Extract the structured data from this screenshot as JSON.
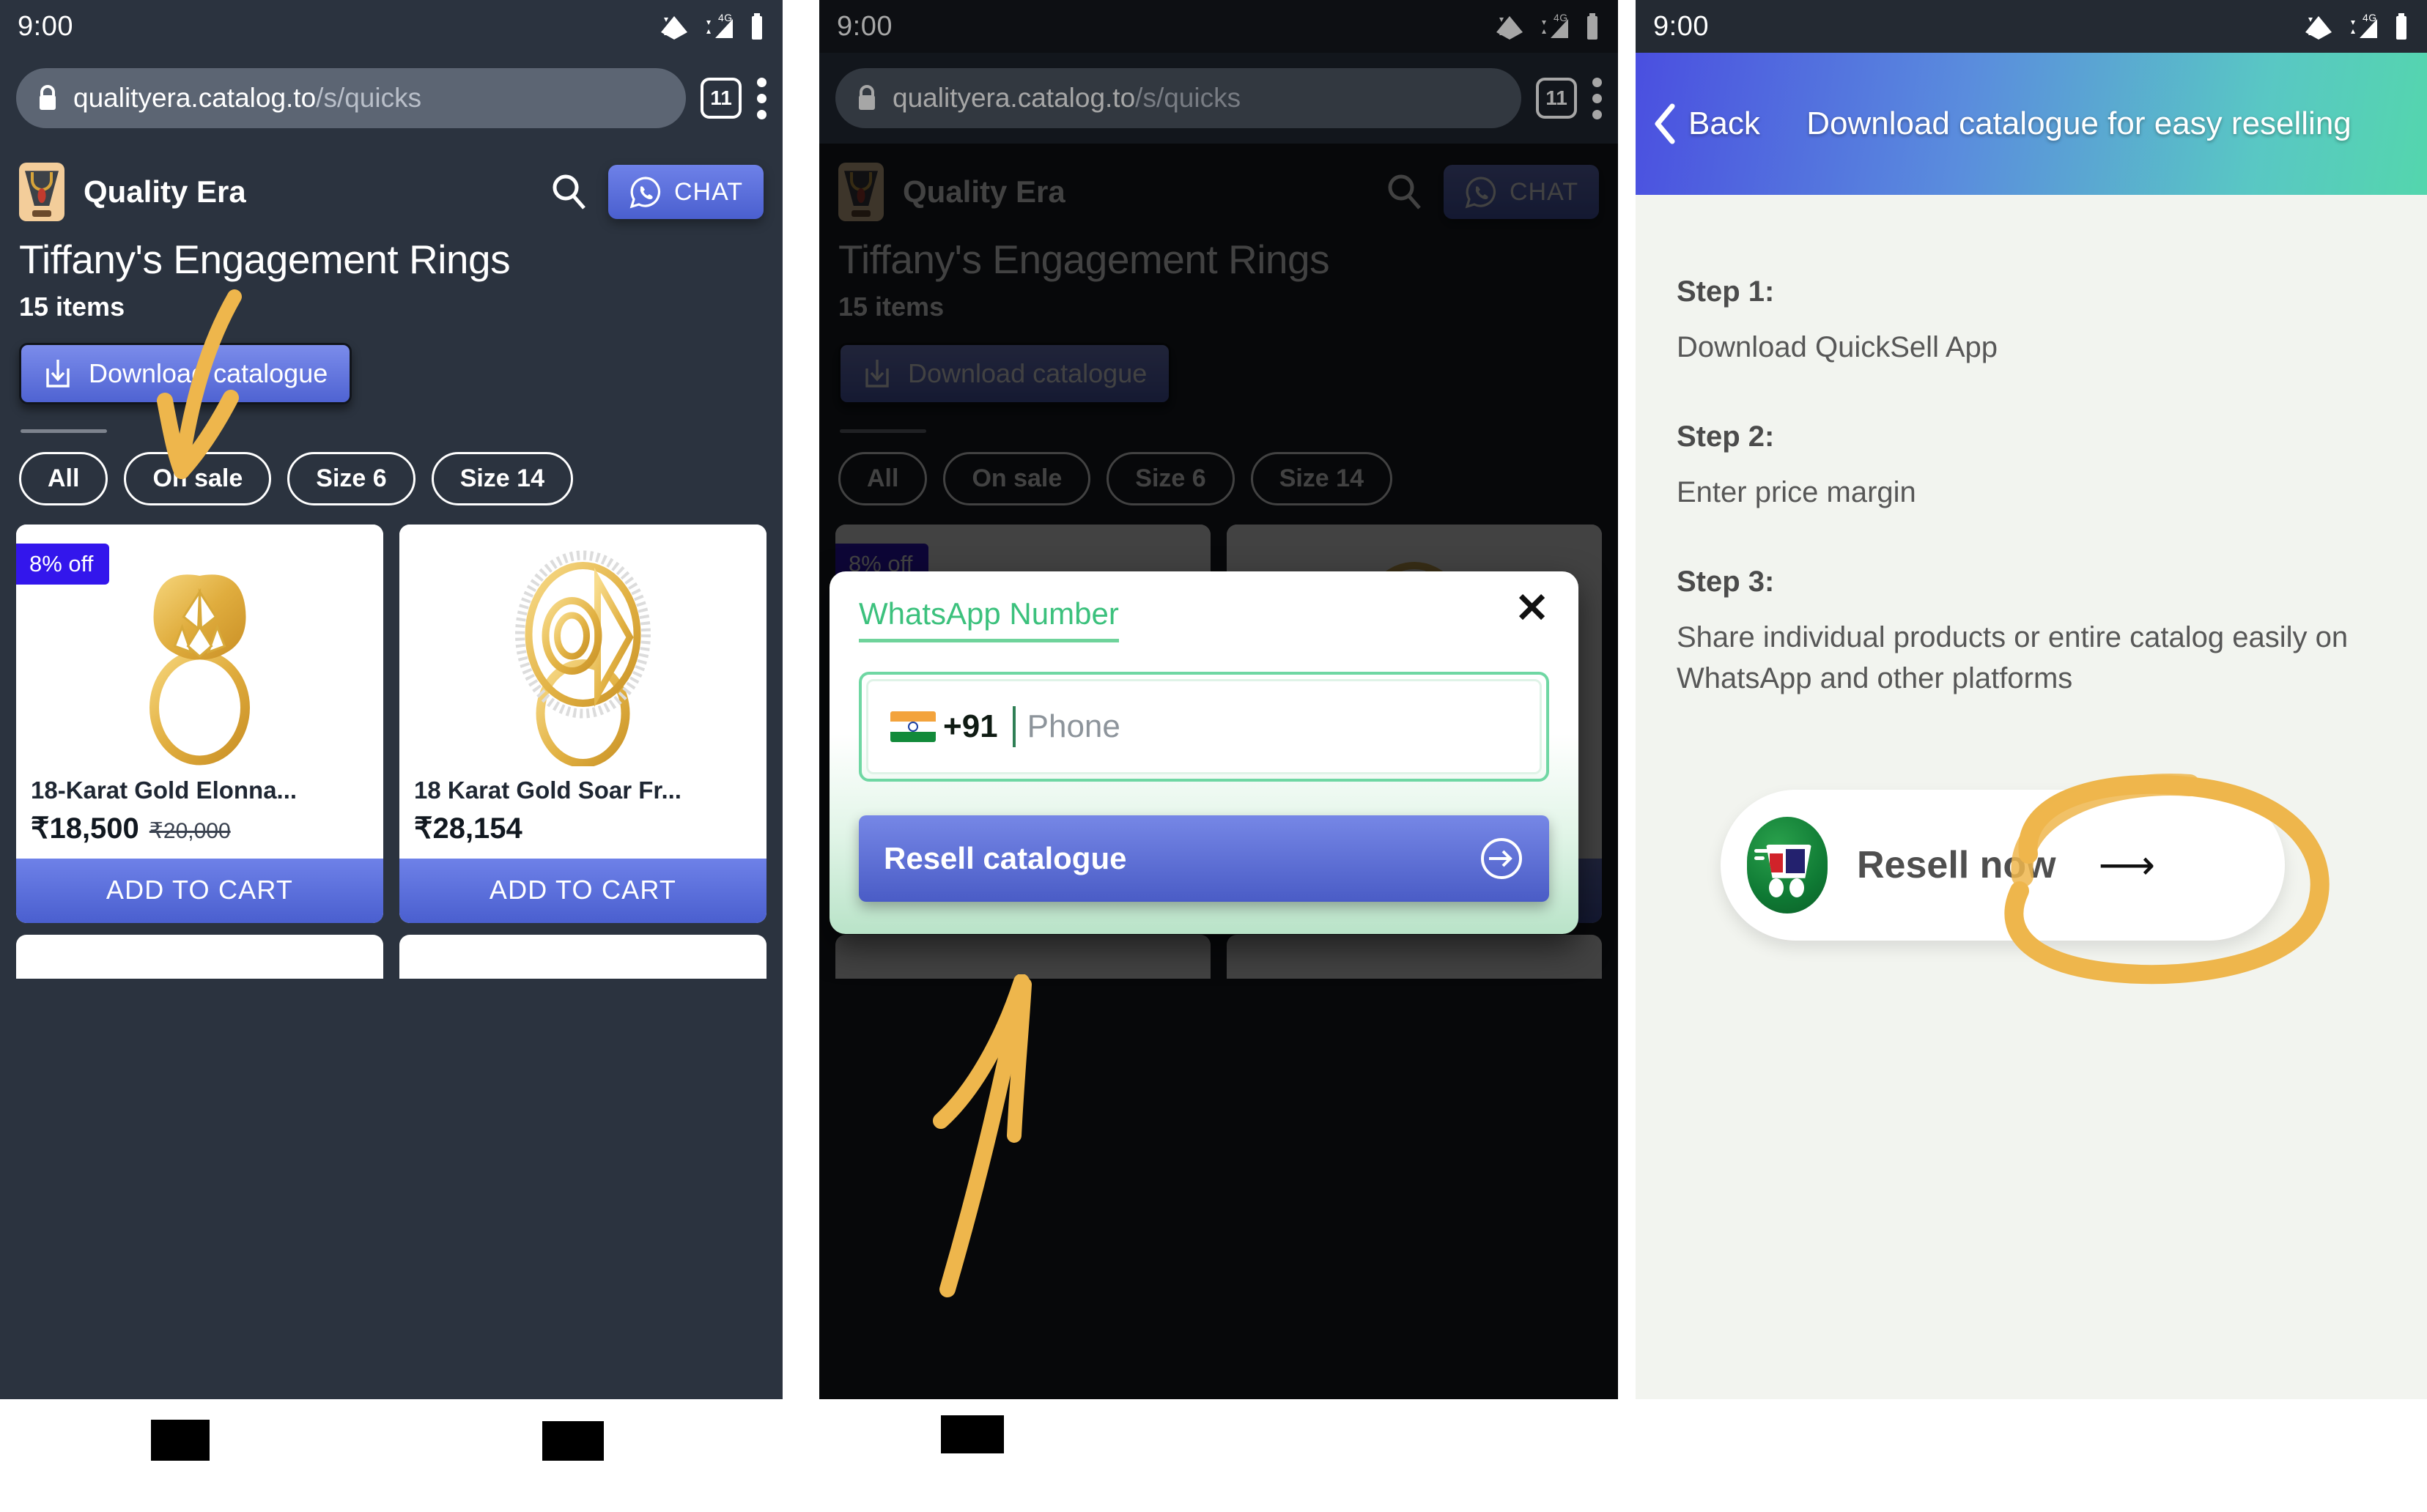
{
  "status_bar": {
    "time": "9:00",
    "network": "4G",
    "icons": [
      "wifi-icon",
      "signal-icon",
      "battery-icon"
    ]
  },
  "browser": {
    "url_main": "qualityera.catalog.to",
    "url_path": "/s/quicks",
    "tab_count": "11",
    "lock_icon": "lock-icon",
    "menu_icon": "kebab-menu-icon"
  },
  "store": {
    "name": "Quality Era",
    "logo_icon": "necklace-logo-icon",
    "search_icon": "search-icon",
    "chat_label": "CHAT",
    "chat_icon": "whatsapp-icon"
  },
  "catalog": {
    "title": "Tiffany's Engagement Rings",
    "item_count": "15 items",
    "download_label": "Download catalogue",
    "download_icon": "download-icon",
    "chips": [
      "All",
      "On sale",
      "Size 6",
      "Size 14"
    ]
  },
  "products": [
    {
      "badge": "8% off",
      "name": "18-Karat Gold Elonna...",
      "price": "₹18,500",
      "old_price": "₹20,000",
      "cta": "ADD TO CART"
    },
    {
      "badge": "",
      "name": "18 Karat Gold Soar Fr...",
      "price": "₹28,154",
      "old_price": "",
      "cta": "ADD TO CART"
    }
  ],
  "modal": {
    "label": "WhatsApp Number",
    "close_icon": "close-icon",
    "country_code": "+91",
    "flag_icon": "india-flag-icon",
    "phone_placeholder": "Phone",
    "phone_value": "",
    "submit_label": "Resell catalogue",
    "submit_icon": "login-arrow-icon"
  },
  "help_screen": {
    "back_label": "Back",
    "back_icon": "chevron-left-icon",
    "title": "Download catalogue for easy reselling",
    "steps": [
      {
        "heading": "Step 1:",
        "text": "Download QuickSell App"
      },
      {
        "heading": "Step 2:",
        "text": "Enter price margin"
      },
      {
        "heading": "Step 3:",
        "text": "Share individual products or entire catalog easily on WhatsApp and other platforms"
      }
    ],
    "resell_label": "Resell now",
    "resell_arrow_icon": "arrow-right-icon",
    "app_icon": "quicksell-cart-icon"
  },
  "colors": {
    "accent_blue": "#4f63d2",
    "whatsapp_green": "#3cc17d",
    "badge_blue": "#3316ec",
    "annotation_orange": "#eeb64c",
    "dark_bg": "#2b333f",
    "light_bg": "#f2f4ef"
  }
}
